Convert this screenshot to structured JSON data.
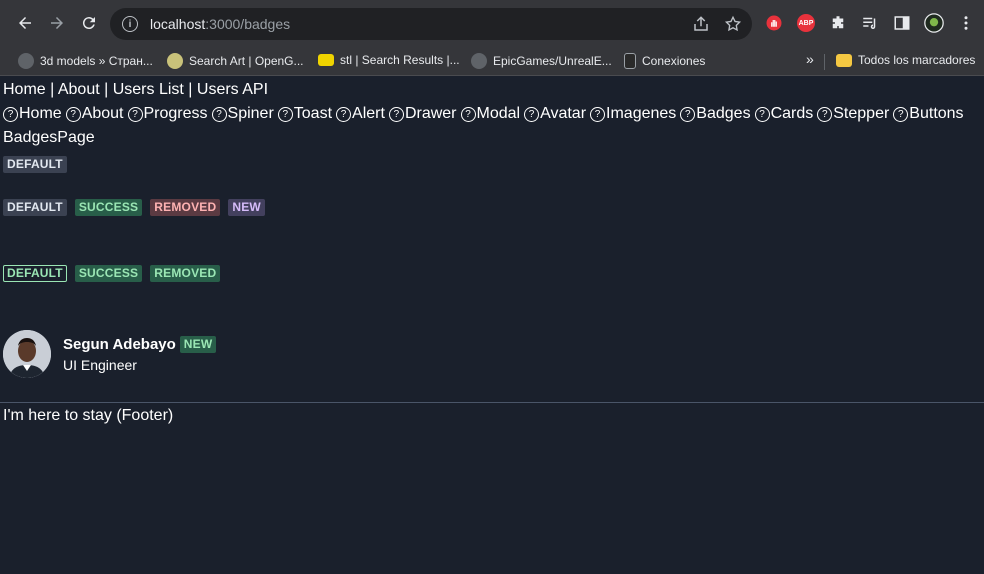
{
  "browser": {
    "url_host": "localhost",
    "url_path": ":3000/badges",
    "bookmarks": [
      {
        "label": "3d models » Стран..."
      },
      {
        "label": "Search Art | OpenG..."
      },
      {
        "label": "stl | Search Results |..."
      },
      {
        "label": "EpicGames/UnrealE..."
      },
      {
        "label": "Conexiones"
      },
      {
        "label": "Todos los marcadores"
      }
    ],
    "ext_abp": "ABP",
    "more_bookmarks": "»"
  },
  "nav": {
    "home": "Home",
    "about": "About",
    "users_list": "Users List",
    "users_api": "Users API",
    "sep": " | "
  },
  "components": [
    "Home",
    "About",
    "Progress",
    "Spiner",
    "Toast",
    "Alert",
    "Drawer",
    "Modal",
    "Avatar",
    "Imagenes",
    "Badges",
    "Cards",
    "Stepper",
    "Buttons"
  ],
  "page_title": "BadgesPage",
  "badges": {
    "single": "DEFAULT",
    "row1": [
      "DEFAULT",
      "SUCCESS",
      "REMOVED",
      "NEW"
    ],
    "row2": [
      "DEFAULT",
      "SUCCESS",
      "REMOVED"
    ]
  },
  "profile": {
    "name": "Segun Adebayo",
    "badge": "NEW",
    "role": "UI Engineer"
  },
  "footer": "I'm here to stay (Footer)",
  "colors": {
    "page_bg": "#1a202c",
    "chrome_bg": "#35363a"
  }
}
